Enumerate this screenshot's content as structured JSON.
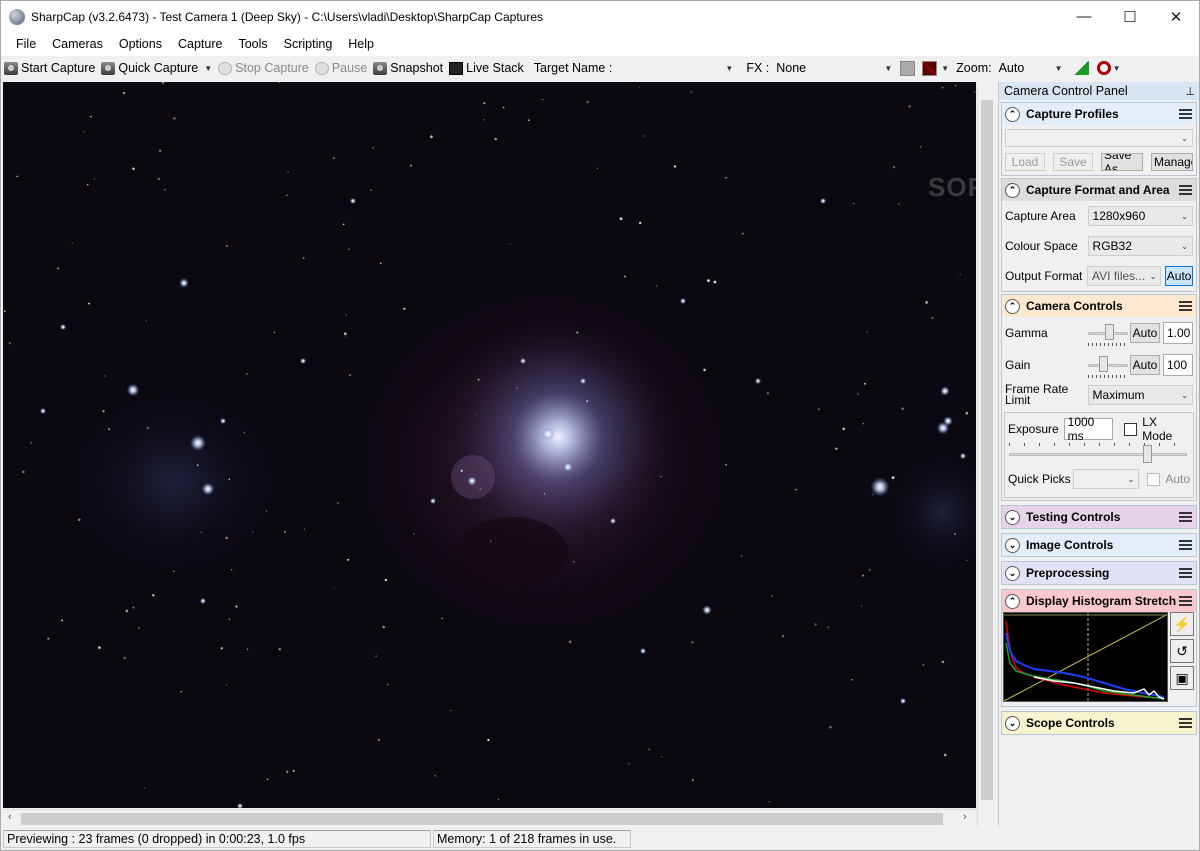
{
  "window": {
    "title": "SharpCap (v3.2.6473) - Test Camera 1 (Deep Sky) - C:\\Users\\vladi\\Desktop\\SharpCap Captures",
    "minimize": "—",
    "maximize": "☐",
    "close": "✕"
  },
  "menu": [
    "File",
    "Cameras",
    "Options",
    "Capture",
    "Tools",
    "Scripting",
    "Help"
  ],
  "toolbar": {
    "start_capture": "Start Capture",
    "quick_capture": "Quick Capture",
    "stop_capture": "Stop Capture",
    "pause": "Pause",
    "snapshot": "Snapshot",
    "live_stack": "Live Stack",
    "target_name_label": "Target Name :",
    "target_name_value": "",
    "fx_label": "FX :",
    "fx_value": "None",
    "zoom_label": "Zoom:",
    "zoom_value": "Auto"
  },
  "panel": {
    "title": "Camera Control Panel",
    "capture_profiles": {
      "title": "Capture Profiles",
      "profile_value": "",
      "load": "Load",
      "save": "Save",
      "save_as": "Save As",
      "manage": "Manage"
    },
    "capture_format": {
      "title": "Capture Format and Area",
      "capture_area_label": "Capture Area",
      "capture_area_value": "1280x960",
      "colour_space_label": "Colour Space",
      "colour_space_value": "RGB32",
      "output_format_label": "Output Format",
      "output_format_value": "AVI files...",
      "auto": "Auto"
    },
    "camera_controls": {
      "title": "Camera Controls",
      "gamma_label": "Gamma",
      "gamma_auto": "Auto",
      "gamma_value": "1.00",
      "gamma_level": 0.55,
      "gain_label": "Gain",
      "gain_auto": "Auto",
      "gain_value": "100",
      "gain_level": 0.35,
      "frame_rate_label": "Frame Rate Limit",
      "frame_rate_value": "Maximum",
      "exposure_label": "Exposure",
      "exposure_value": "1000 ms",
      "lx_mode": "LX Mode",
      "exposure_level": 0.78,
      "quick_picks_label": "Quick Picks",
      "quick_picks_value": "",
      "auto": "Auto"
    },
    "testing_controls": "Testing Controls",
    "image_controls": "Image Controls",
    "preprocessing": "Preprocessing",
    "histogram_stretch": "Display Histogram Stretch",
    "scope_controls": "Scope Controls"
  },
  "colors": {
    "camera_controls_header": "#fde9d0",
    "testing_header": "#e6d3ea",
    "image_header": "#e3eefa",
    "preprocessing_header": "#e2e2f6",
    "histogram_header": "#f9c7cc",
    "scope_header": "#f7f3cf",
    "capture_profiles_header": "#e3eefa",
    "capture_format_header": "#dcdcdc"
  },
  "watermark": "SOFTPEDIA",
  "status": {
    "preview": "Previewing : 23 frames (0 dropped) in 0:00:23, 1.0 fps",
    "memory": "Memory: 1 of 218 frames in use."
  }
}
